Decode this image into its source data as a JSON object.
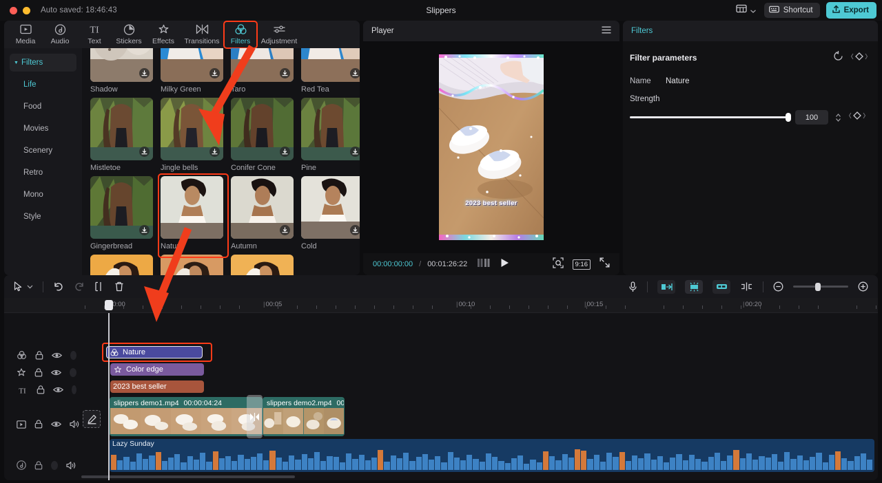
{
  "titlebar": {
    "autosave": "Auto saved: 18:46:43",
    "app_title": "Slippers",
    "shortcut_label": "Shortcut",
    "export_label": "Export",
    "layout_icon": "layout-icon",
    "chevron_icon": "chevron-down-icon",
    "keyboard_icon": "keyboard-icon",
    "upload_icon": "upload-icon"
  },
  "library": {
    "tabs": [
      {
        "label": "Media",
        "icon": "media-icon",
        "active": false
      },
      {
        "label": "Audio",
        "icon": "audio-icon",
        "active": false
      },
      {
        "label": "Text",
        "icon": "text-icon",
        "active": false
      },
      {
        "label": "Stickers",
        "icon": "stickers-icon",
        "active": false
      },
      {
        "label": "Effects",
        "icon": "effects-icon",
        "active": false
      },
      {
        "label": "Transitions",
        "icon": "transitions-icon",
        "active": false
      },
      {
        "label": "Filters",
        "icon": "filters-icon",
        "active": true
      },
      {
        "label": "Adjustment",
        "icon": "adjustment-icon",
        "active": false
      }
    ],
    "nav": [
      {
        "label": "Filters",
        "root": true
      },
      {
        "label": "Life",
        "selected": true
      },
      {
        "label": "Food"
      },
      {
        "label": "Movies"
      },
      {
        "label": "Scenery"
      },
      {
        "label": "Retro"
      },
      {
        "label": "Mono"
      },
      {
        "label": "Style"
      }
    ],
    "rows": [
      {
        "items": [
          {
            "name": "Shadow",
            "download": true
          },
          {
            "name": "Milky Green",
            "download": true
          },
          {
            "name": "Taro",
            "download": true
          },
          {
            "name": "Red Tea",
            "download": true
          }
        ]
      },
      {
        "items": [
          {
            "name": "Mistletoe",
            "download": true
          },
          {
            "name": "Jingle bells",
            "download": true
          },
          {
            "name": "Conifer Cone",
            "download": true
          },
          {
            "name": "Pine",
            "download": true
          }
        ]
      },
      {
        "items": [
          {
            "name": "Gingerbread",
            "download": true
          },
          {
            "name": "Nature",
            "download": false,
            "selected": true
          },
          {
            "name": "Autumn",
            "download": true
          },
          {
            "name": "Cold",
            "download": true
          }
        ]
      }
    ]
  },
  "player": {
    "title": "Player",
    "menu_icon": "hamburger-icon",
    "current_time": "00:00:00:00",
    "separator": "/",
    "total_time": "00:01:26:22",
    "caption": "2023 best seller",
    "quality_icon": "quality-icon",
    "play_icon": "play-icon",
    "snapshot_icon": "snapshot-icon",
    "aspect_ratio": "9:16",
    "fullscreen_icon": "fullscreen-icon"
  },
  "filters_panel": {
    "title": "Filters",
    "section_title": "Filter parameters",
    "reset_icon": "reset-icon",
    "keyframe_icon": "keyframe-diamond-icon",
    "name_label": "Name",
    "name_value": "Nature",
    "strength_label": "Strength",
    "strength_value": "100",
    "strength_percent": 100
  },
  "timeline": {
    "toolbar": {
      "cursor_icon": "cursor-icon",
      "cursor_chevron_icon": "chevron-down-icon",
      "undo_icon": "undo-icon",
      "redo_icon": "redo-icon",
      "split_icon": "split-icon",
      "delete_icon": "trash-icon",
      "mic_icon": "microphone-icon",
      "crop_icon": "crop-icon",
      "freeze_icon": "freeze-frame-icon",
      "link_icon": "link-icon",
      "marker_icon": "marker-icon",
      "zoom_out_icon": "zoom-out-icon",
      "zoom_in_icon": "zoom-in-icon",
      "zoom_level": 45
    },
    "ruler_labels": [
      "00:00",
      "00:05",
      "00:10",
      "00:15",
      "00:20"
    ],
    "track_headers": [
      {
        "icon": "filters-track-icon",
        "lock": "lock-icon",
        "eye": "eye-icon",
        "placeholder": true,
        "mute": false
      },
      {
        "icon": "effects-track-icon",
        "lock": "lock-icon",
        "eye": "eye-icon",
        "placeholder": true,
        "mute": false
      },
      {
        "icon": "text-track-icon",
        "lock": "lock-icon",
        "eye": "eye-icon",
        "placeholder": true,
        "mute": false
      },
      {
        "icon": "video-track-icon",
        "lock": "lock-icon",
        "eye": "eye-icon",
        "placeholder": false,
        "mute": true
      },
      {
        "icon": "audio-track-icon",
        "lock": "lock-icon",
        "eye": "",
        "placeholder": true,
        "mute": true
      }
    ],
    "clips": {
      "filter": {
        "label": "Nature",
        "icon": "filters-icon"
      },
      "effect": {
        "label": "Color edge",
        "icon": "effects-icon"
      },
      "text": {
        "label": "2023 best seller"
      },
      "video1": {
        "label": "slippers demo1.mp4",
        "duration": "00:00:04:24"
      },
      "video2": {
        "label": "slippers demo2.mp4",
        "duration": "00:0"
      },
      "transition": {
        "icon": "transition-icon"
      },
      "audio": {
        "label": "Lazy Sunday"
      }
    },
    "edit_button_icon": "pencil-edit-icon"
  },
  "annotations": {
    "arrow_to_nature_thumb": "red-arrow",
    "arrow_to_nature_clip": "red-arrow",
    "highlight_filters_tab": "red-box",
    "highlight_nature_thumb": "red-box",
    "highlight_nature_clip": "red-box"
  },
  "colors": {
    "accent": "#4ec9d4",
    "annotation": "#ff3b18",
    "filter_clip": "#4a4a9e",
    "effect_clip": "#7a5a9e",
    "text_clip": "#a8553c",
    "video_clip": "#2d6b63",
    "audio_clip": "#163a63"
  }
}
